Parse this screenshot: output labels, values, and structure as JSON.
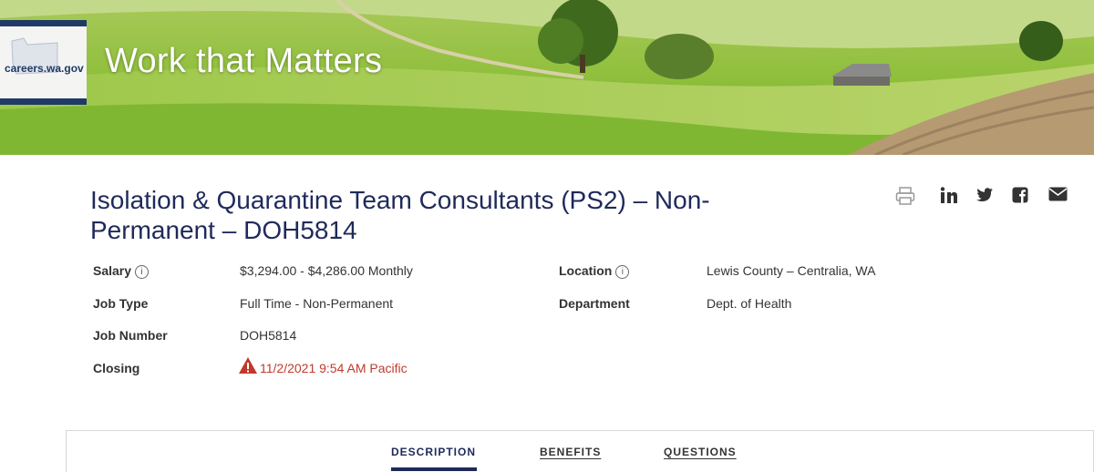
{
  "banner": {
    "logo_text": "careers.wa.gov",
    "title": "Work that Matters"
  },
  "job": {
    "title": "Isolation & Quarantine Team Consultants (PS2) – Non-Permanent – DOH5814",
    "salary_label": "Salary",
    "salary": "$3,294.00 - $4,286.00 Monthly",
    "job_type_label": "Job Type",
    "job_type": "Full Time - Non-Permanent",
    "job_number_label": "Job Number",
    "job_number": "DOH5814",
    "closing_label": "Closing",
    "closing": "11/2/2021 9:54 AM Pacific",
    "location_label": "Location",
    "location": "Lewis County – Centralia, WA",
    "department_label": "Department",
    "department": "Dept. of Health"
  },
  "share_icons": [
    "print-icon",
    "linkedin-icon",
    "twitter-icon",
    "facebook-icon",
    "email-icon"
  ],
  "tabs": [
    {
      "label": "DESCRIPTION",
      "active": true
    },
    {
      "label": "BENEFITS",
      "active": false
    },
    {
      "label": "QUESTIONS",
      "active": false
    }
  ],
  "colors": {
    "title": "#1f2a5a",
    "alert": "#c0392b"
  }
}
